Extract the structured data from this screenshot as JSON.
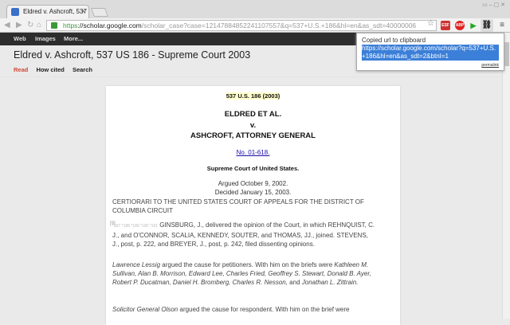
{
  "tab": {
    "title": "Eldred v. Ashcroft, 537"
  },
  "toolbar": {
    "url_scheme": "https",
    "url_host": "://scholar.google.com",
    "url_rest": "/scholar_case?case=12147884852241107557&q=537+U.S.+186&hl=en&as_sdt=40000006",
    "ext_badge": "ESF"
  },
  "navbar": {
    "items": [
      "Web",
      "Images",
      "More..."
    ]
  },
  "page": {
    "title": "Eldred v. Ashcroft, 537 US 186 - Supreme Court 2003",
    "subnav": [
      "Read",
      "How cited",
      "Search"
    ]
  },
  "doc": {
    "citation": "537 U.S. 186 (2003)",
    "party1": "ELDRED ET AL.",
    "v": "v.",
    "party2": "ASHCROFT, ATTORNEY GENERAL",
    "docket": "No. 01-618.",
    "court": "Supreme Court of United States.",
    "argued": "Argued October 9, 2002.",
    "decided": "Decided January 15, 2003.",
    "certiorari": "CERTIORARI TO THE UNITED STATES COURT OF APPEALS FOR THE DISTRICT OF COLUMBIA CIRCUIT",
    "margin_note": "[9]",
    "page_refs": "*187 *188 *189 *190 *191",
    "para1": "GINSBURG, J., delivered the opinion of the Court, in which REHNQUIST, C. J., and O'CONNOR, SCALIA, KENNEDY, SOUTER, and THOMAS, JJ., joined. STEVENS, J., post, p. 222, and BREYER, J., post, p. 242, filed dissenting opinions.",
    "para2_name": "Lawrence Lessig",
    "para2_rest": " argued the cause for petitioners. With him on the briefs were ",
    "para2_names": "Kathleen M. Sullivan, Alan B. Morrison, Edward Lee, Charles Fried, Geoffrey S. Stewart, Donald B. Ayer, Robert P. Ducatman, Daniel H. Bromberg, Charles R. Nesson,",
    "para2_and": " and ",
    "para2_last": "Jonathan L. Zittrain.",
    "para3_name": "Solicitor General Olson",
    "para3_rest": " argued the cause for respondent. With him on the brief were"
  },
  "popup": {
    "message": "Copied url to clipboard",
    "url": "https://scholar.google.com/scholar?q=537+U.S.+186&hl=en&as_sdt=2&btnI=1",
    "permalink": "permalink"
  }
}
